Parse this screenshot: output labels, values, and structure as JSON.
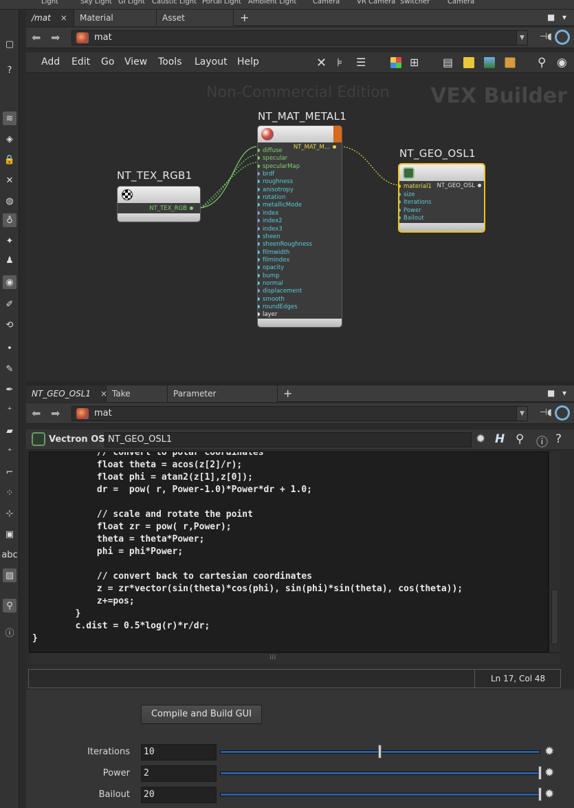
{
  "top_shelf": [
    "Light",
    "Sky Light",
    "GI Light",
    "Caustic Light",
    "Portal Light",
    "Ambient Light",
    "Camera",
    "VR Camera",
    "Switcher",
    "Camera"
  ],
  "network_pane": {
    "tabs": [
      {
        "label": "/mat",
        "close": "×"
      },
      {
        "label": "Material Palette",
        "close": "×"
      },
      {
        "label": "Asset Browser",
        "close": "×"
      }
    ],
    "add_tab": "+",
    "path": "mat",
    "menu": [
      "Add",
      "Edit",
      "Go",
      "View",
      "Tools",
      "Layout",
      "Help"
    ],
    "watermark": "Non-Commercial Edition",
    "context_label": "VEX Builder",
    "nodes": {
      "tex": {
        "title": "NT_TEX_RGB1",
        "output": "NT_TEX_RGB"
      },
      "metal": {
        "title": "NT_MAT_METAL1",
        "output": "NT_MAT_M...",
        "inputs": [
          "diffuse",
          "specular",
          "specularMap",
          "brdf",
          "roughness",
          "anisotropy",
          "rotation",
          "metallicMode",
          "index",
          "index2",
          "index3",
          "sheen",
          "sheenRoughness",
          "filmwidth",
          "filmindex",
          "opacity",
          "bump",
          "normal",
          "displacement",
          "smooth",
          "roundEdges",
          "layer"
        ]
      },
      "geo": {
        "title": "NT_GEO_OSL1",
        "output": "NT_GEO_OSL",
        "inputs": [
          "material1",
          "size",
          "Iterations",
          "Power",
          "Bailout"
        ]
      }
    },
    "colors": {
      "wire_green": "#7ed06e",
      "wire_yellow": "#e8d84a",
      "selected_border": "#f0c419",
      "metal_accent": "#d86a1a"
    }
  },
  "param_pane": {
    "tabs": [
      {
        "label": "NT_GEO_OSL1",
        "close": "×"
      },
      {
        "label": "Take List",
        "close": "×"
      },
      {
        "label": "Parameter Spreadsheet",
        "close": "×"
      }
    ],
    "add_tab": "+",
    "path": "mat",
    "operator_type": "Vectron OSL",
    "operator_name": "NT_GEO_OSL1",
    "code_lines": [
      "            // convert to polar coordinates",
      "            float theta = acos(z[2]/r);",
      "            float phi = atan2(z[1],z[0]);",
      "            dr =  pow( r, Power-1.0)*Power*dr + 1.0;",
      "",
      "            // scale and rotate the point",
      "            float zr = pow( r,Power);",
      "            theta = theta*Power;",
      "            phi = phi*Power;",
      "",
      "            // convert back to cartesian coordinates",
      "            z = zr*vector(sin(theta)*cos(phi), sin(phi)*sin(theta), cos(theta));",
      "            z+=pos;",
      "        }",
      "        c.dist = 0.5*log(r)*r/dr;",
      "}"
    ],
    "cursor_status": "Ln 17, Col 48",
    "compile_button": "Compile and Build GUI",
    "parameters": [
      {
        "label": "Iterations",
        "value": "10",
        "slider_fraction": 0.5
      },
      {
        "label": "Power",
        "value": "2",
        "slider_fraction": 1.0
      },
      {
        "label": "Bailout",
        "value": "20",
        "slider_fraction": 1.0
      }
    ]
  }
}
